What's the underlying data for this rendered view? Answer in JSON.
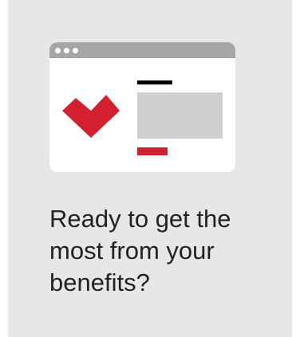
{
  "card": {
    "headline": "Ready to get the\nmost from your\nbenefits?",
    "background_color": "#e7e7e7"
  },
  "illustration": {
    "type": "browser-window",
    "icons": [
      "window-dots-icon",
      "heart-icon"
    ],
    "accent_color": "#d3202e",
    "titlebar_color": "#a6a6a6",
    "placeholder_color": "#cfcfcf"
  }
}
